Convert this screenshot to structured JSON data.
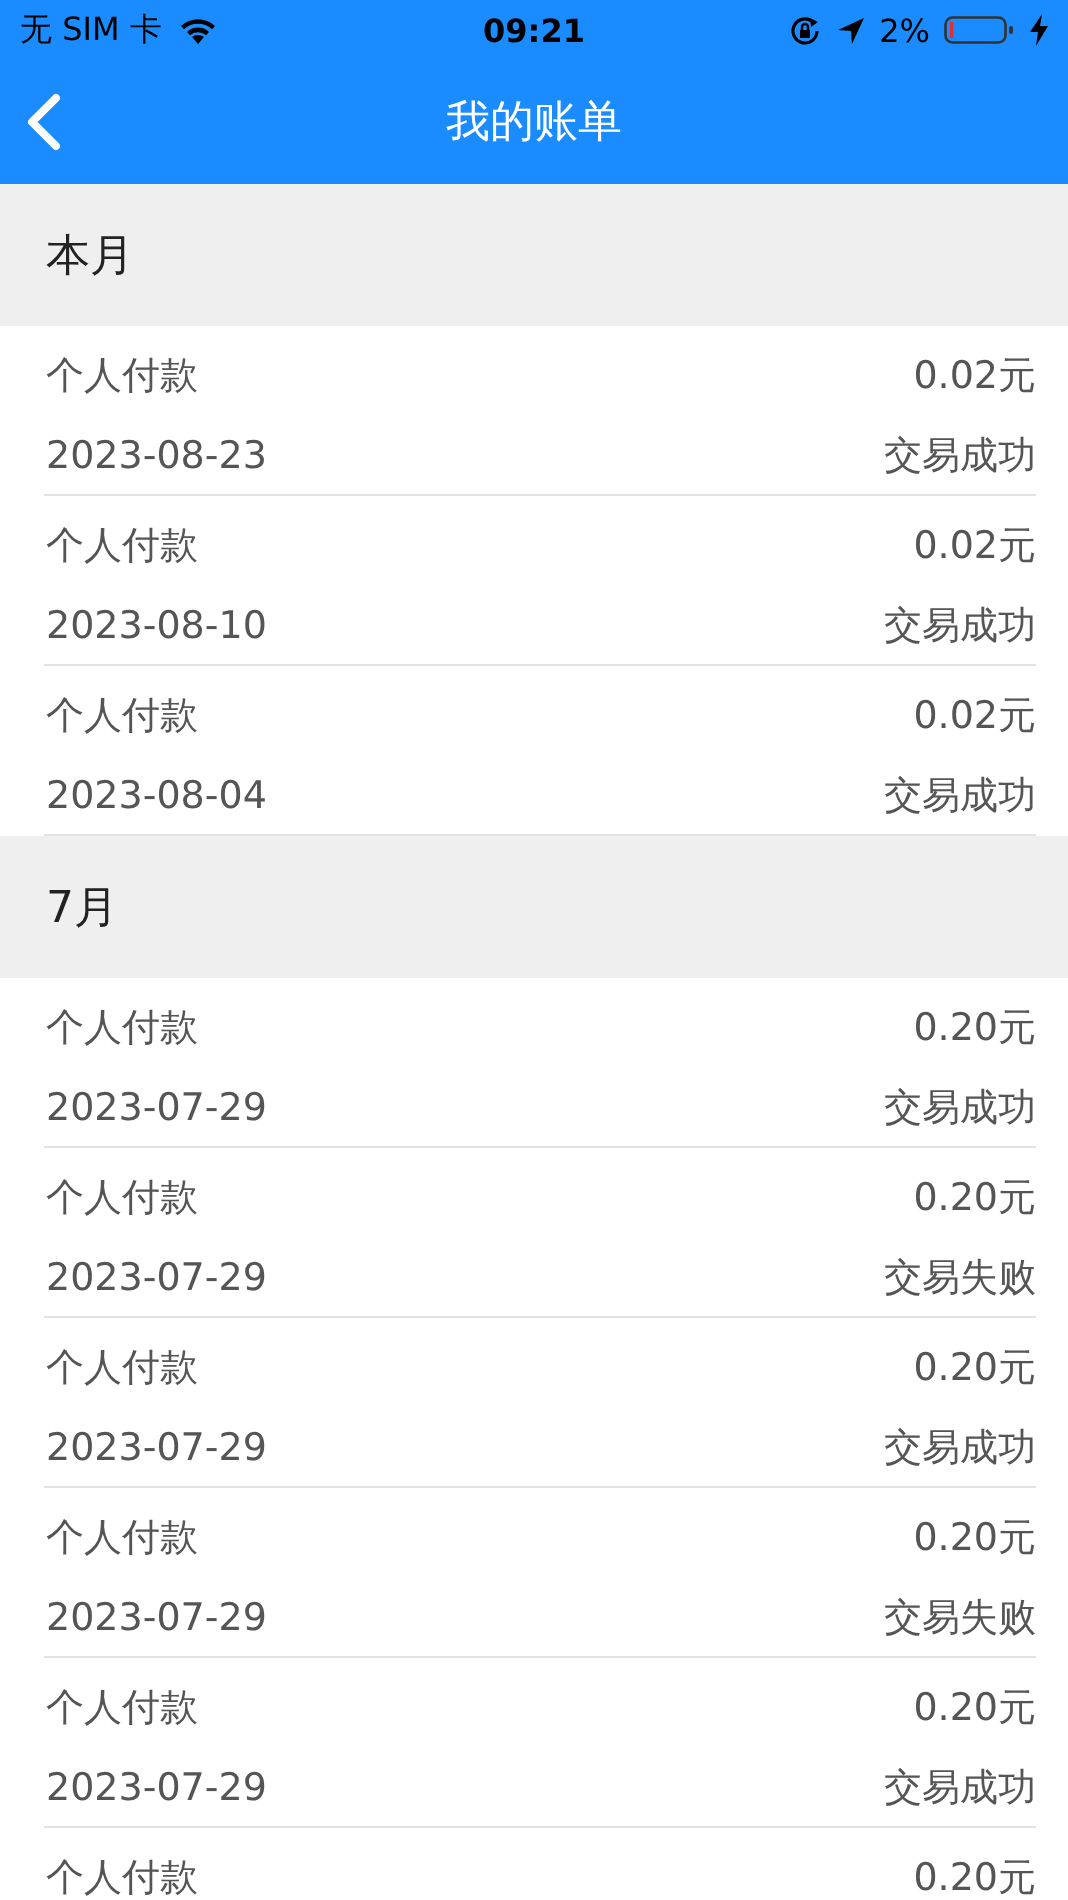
{
  "status_bar": {
    "carrier": "无 SIM 卡",
    "time": "09:21",
    "battery": "2%"
  },
  "nav": {
    "title": "我的账单"
  },
  "sections": [
    {
      "title": "本月",
      "rows": [
        {
          "name": "个人付款",
          "amount": "0.02元",
          "date": "2023-08-23",
          "status": "交易成功"
        },
        {
          "name": "个人付款",
          "amount": "0.02元",
          "date": "2023-08-10",
          "status": "交易成功"
        },
        {
          "name": "个人付款",
          "amount": "0.02元",
          "date": "2023-08-04",
          "status": "交易成功"
        }
      ]
    },
    {
      "title": "7月",
      "rows": [
        {
          "name": "个人付款",
          "amount": "0.20元",
          "date": "2023-07-29",
          "status": "交易成功"
        },
        {
          "name": "个人付款",
          "amount": "0.20元",
          "date": "2023-07-29",
          "status": "交易失败"
        },
        {
          "name": "个人付款",
          "amount": "0.20元",
          "date": "2023-07-29",
          "status": "交易成功"
        },
        {
          "name": "个人付款",
          "amount": "0.20元",
          "date": "2023-07-29",
          "status": "交易失败"
        },
        {
          "name": "个人付款",
          "amount": "0.20元",
          "date": "2023-07-29",
          "status": "交易成功"
        },
        {
          "name": "个人付款",
          "amount": "0.20元"
        }
      ]
    }
  ]
}
